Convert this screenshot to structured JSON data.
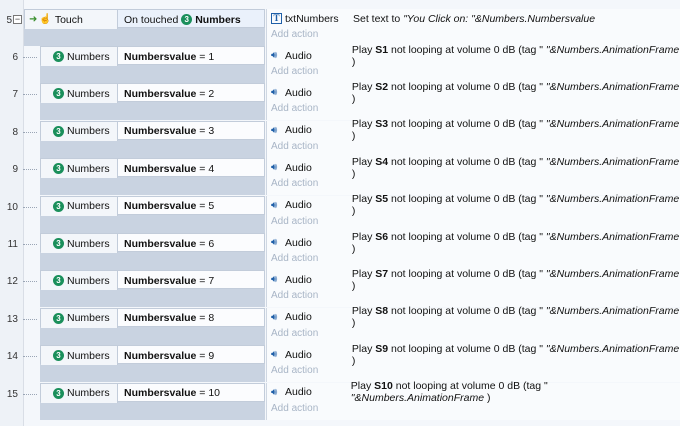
{
  "first_event": {
    "line": "5",
    "collapse_symbol": "−",
    "object": "Touch",
    "condition_prefix": "On touched",
    "condition_badge": "3",
    "condition_object": "Numbers",
    "action_object": "txtNumbers",
    "action_text_prefix": "Set text to ",
    "action_text_value": "\"You Click on: \"&Numbers.Numbersvalue",
    "add_action": "Add action"
  },
  "events": [
    {
      "line": "6",
      "object": "Numbers",
      "badge": "3",
      "field": "Numbersvalue",
      "op": "= 1",
      "action_object": "Audio",
      "play": "Play ",
      "sound": "S1",
      "rest": " not looping at volume 0 dB (tag \" ",
      "tag": "\"&Numbers.AnimationFrame",
      ")": " )",
      "add_action": "Add action"
    },
    {
      "line": "7",
      "object": "Numbers",
      "badge": "3",
      "field": "Numbersvalue",
      "op": "= 2",
      "action_object": "Audio",
      "play": "Play ",
      "sound": "S2",
      "rest": " not looping at volume 0 dB (tag \" ",
      "tag": "\"&Numbers.AnimationFrame",
      ")": " )",
      "add_action": "Add action"
    },
    {
      "line": "8",
      "object": "Numbers",
      "badge": "3",
      "field": "Numbersvalue",
      "op": "= 3",
      "action_object": "Audio",
      "play": "Play ",
      "sound": "S3",
      "rest": " not looping at volume 0 dB (tag \" ",
      "tag": "\"&Numbers.AnimationFrame",
      ")": " )",
      "add_action": "Add action"
    },
    {
      "line": "9",
      "object": "Numbers",
      "badge": "3",
      "field": "Numbersvalue",
      "op": "= 4",
      "action_object": "Audio",
      "play": "Play ",
      "sound": "S4",
      "rest": " not looping at volume 0 dB (tag \" ",
      "tag": "\"&Numbers.AnimationFrame",
      ")": " )",
      "add_action": "Add action"
    },
    {
      "line": "10",
      "object": "Numbers",
      "badge": "3",
      "field": "Numbersvalue",
      "op": "= 5",
      "action_object": "Audio",
      "play": "Play ",
      "sound": "S5",
      "rest": " not looping at volume 0 dB (tag \" ",
      "tag": "\"&Numbers.AnimationFrame",
      ")": " )",
      "add_action": "Add action"
    },
    {
      "line": "11",
      "object": "Numbers",
      "badge": "3",
      "field": "Numbersvalue",
      "op": "= 6",
      "action_object": "Audio",
      "play": "Play ",
      "sound": "S6",
      "rest": " not looping at volume 0 dB (tag \" ",
      "tag": "\"&Numbers.AnimationFrame",
      ")": " )",
      "add_action": "Add action"
    },
    {
      "line": "12",
      "object": "Numbers",
      "badge": "3",
      "field": "Numbersvalue",
      "op": "= 7",
      "action_object": "Audio",
      "play": "Play ",
      "sound": "S7",
      "rest": " not looping at volume 0 dB (tag \" ",
      "tag": "\"&Numbers.AnimationFrame",
      ")": " )",
      "add_action": "Add action"
    },
    {
      "line": "13",
      "object": "Numbers",
      "badge": "3",
      "field": "Numbersvalue",
      "op": "= 8",
      "action_object": "Audio",
      "play": "Play ",
      "sound": "S8",
      "rest": " not looping at volume 0 dB (tag \" ",
      "tag": "\"&Numbers.AnimationFrame",
      ")": " )",
      "add_action": "Add action"
    },
    {
      "line": "14",
      "object": "Numbers",
      "badge": "3",
      "field": "Numbersvalue",
      "op": "= 9",
      "action_object": "Audio",
      "play": "Play ",
      "sound": "S9",
      "rest": " not looping at volume 0 dB (tag \" ",
      "tag": "\"&Numbers.AnimationFrame",
      ")": " )",
      "add_action": "Add action"
    },
    {
      "line": "15",
      "object": "Numbers",
      "badge": "3",
      "field": "Numbersvalue",
      "op": "= 10",
      "action_object": "Audio",
      "play": "Play ",
      "sound": "S10",
      "rest": " not looping at volume 0 dB (tag \" ",
      "tag": "\"&Numbers.AnimationFrame",
      ")": " )",
      "add_action": "Add action"
    }
  ],
  "icons": {
    "touch": "hand-touch-icon",
    "arrow": "green-arrow-icon",
    "audio": "speaker-icon",
    "text": "text-object-icon",
    "badge": "object-badge-icon"
  },
  "colors": {
    "badge": "#1a8f5b",
    "event_bg": "#c9d3e1",
    "add_action": "#a8b5c6"
  }
}
